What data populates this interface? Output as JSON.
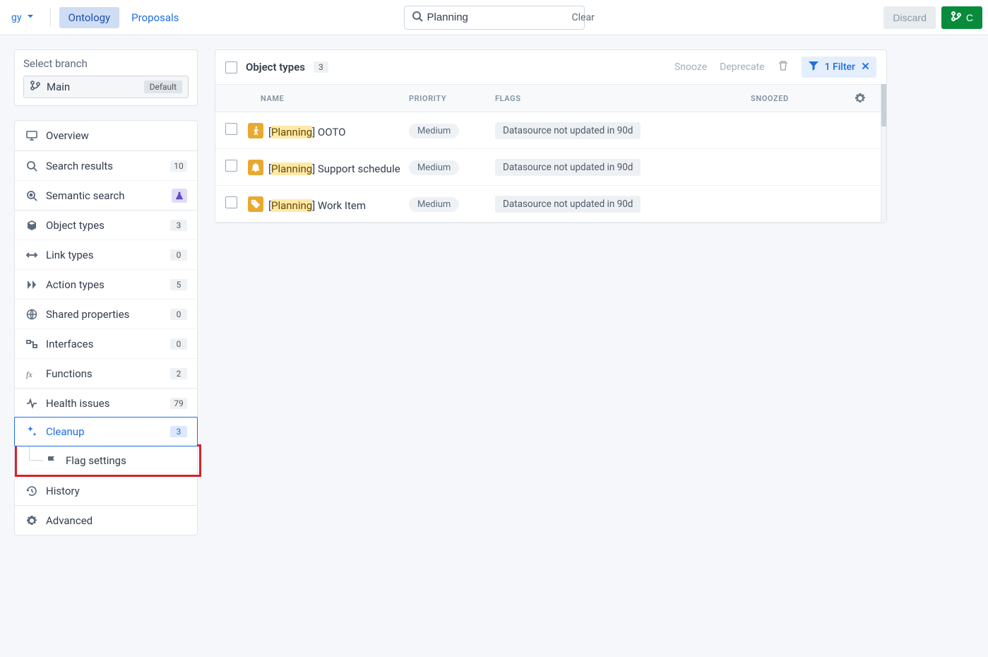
{
  "topbar": {
    "nav_label": "gy",
    "tabs": {
      "ontology": "Ontology",
      "proposals": "Proposals"
    },
    "search_value": "Planning",
    "search_clear": "Clear",
    "discard": "Discard",
    "create": "C"
  },
  "branch": {
    "label": "Select branch",
    "name": "Main",
    "default_badge": "Default"
  },
  "sidebar": {
    "items": [
      {
        "key": "overview",
        "label": "Overview"
      },
      {
        "key": "search-results",
        "label": "Search results",
        "count": "10"
      },
      {
        "key": "semantic-search",
        "label": "Semantic search",
        "flask": true
      },
      {
        "key": "object-types",
        "label": "Object types",
        "count": "3"
      },
      {
        "key": "link-types",
        "label": "Link types",
        "count": "0"
      },
      {
        "key": "action-types",
        "label": "Action types",
        "count": "5"
      },
      {
        "key": "shared-properties",
        "label": "Shared properties",
        "count": "0"
      },
      {
        "key": "interfaces",
        "label": "Interfaces",
        "count": "0"
      },
      {
        "key": "functions",
        "label": "Functions",
        "count": "2"
      },
      {
        "key": "health-issues",
        "label": "Health issues",
        "count": "79"
      },
      {
        "key": "cleanup",
        "label": "Cleanup",
        "count": "3",
        "active": true
      },
      {
        "key": "flag-settings",
        "label": "Flag settings",
        "sub": true,
        "highlight": true
      },
      {
        "key": "history",
        "label": "History"
      },
      {
        "key": "advanced",
        "label": "Advanced"
      }
    ]
  },
  "main": {
    "title": "Object types",
    "count_badge": "3",
    "actions": {
      "snooze": "Snooze",
      "deprecate": "Deprecate"
    },
    "filter_label": "1 Filter",
    "columns": {
      "name": "NAME",
      "priority": "PRIORITY",
      "flags": "FLAGS",
      "snoozed": "SNOOZED"
    },
    "rows": [
      {
        "highlight": "Planning",
        "rest": " OOTO",
        "prio": "Medium",
        "flag": "Datasource not updated in 90d",
        "icon": "walk"
      },
      {
        "highlight": "Planning",
        "rest": " Support schedule",
        "prio": "Medium",
        "flag": "Datasource not updated in 90d",
        "icon": "bell"
      },
      {
        "highlight": "Planning",
        "rest": " Work Item",
        "prio": "Medium",
        "flag": "Datasource not updated in 90d",
        "icon": "tag"
      }
    ]
  }
}
